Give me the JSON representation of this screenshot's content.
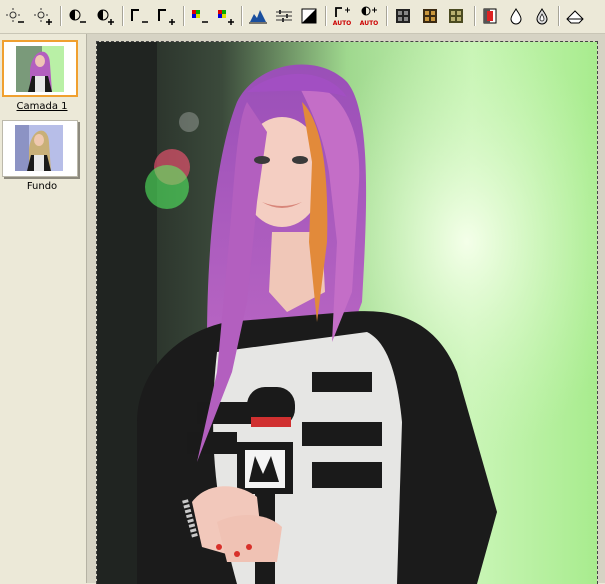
{
  "toolbar": {
    "tools": [
      {
        "name": "brightness-decrease-icon"
      },
      {
        "name": "brightness-increase-icon"
      },
      {
        "name": "contrast-decrease-icon"
      },
      {
        "name": "contrast-increase-icon"
      },
      {
        "name": "gamma-decrease-icon"
      },
      {
        "name": "gamma-increase-icon"
      },
      {
        "name": "saturation-decrease-icon"
      },
      {
        "name": "saturation-increase-icon"
      },
      {
        "name": "levels-icon"
      },
      {
        "name": "curves-sliders-icon"
      },
      {
        "name": "threshold-icon"
      },
      {
        "name": "auto-gamma-icon",
        "label": "AUTO"
      },
      {
        "name": "auto-contrast-icon",
        "label": "AUTO"
      },
      {
        "name": "filter-grid-icon"
      },
      {
        "name": "filter-sepia-icon"
      },
      {
        "name": "filter-olive-icon"
      },
      {
        "name": "invert-icon"
      },
      {
        "name": "drop-icon"
      },
      {
        "name": "drop-outline-icon"
      },
      {
        "name": "eraser-icon"
      }
    ]
  },
  "layers": [
    {
      "label": "Camada 1",
      "selected": true
    },
    {
      "label": "Fundo",
      "selected": false
    }
  ],
  "colors": {
    "panel": "#ECE9D8",
    "selection": "#F0A030",
    "canvas_bg": "#D6D3C4"
  }
}
